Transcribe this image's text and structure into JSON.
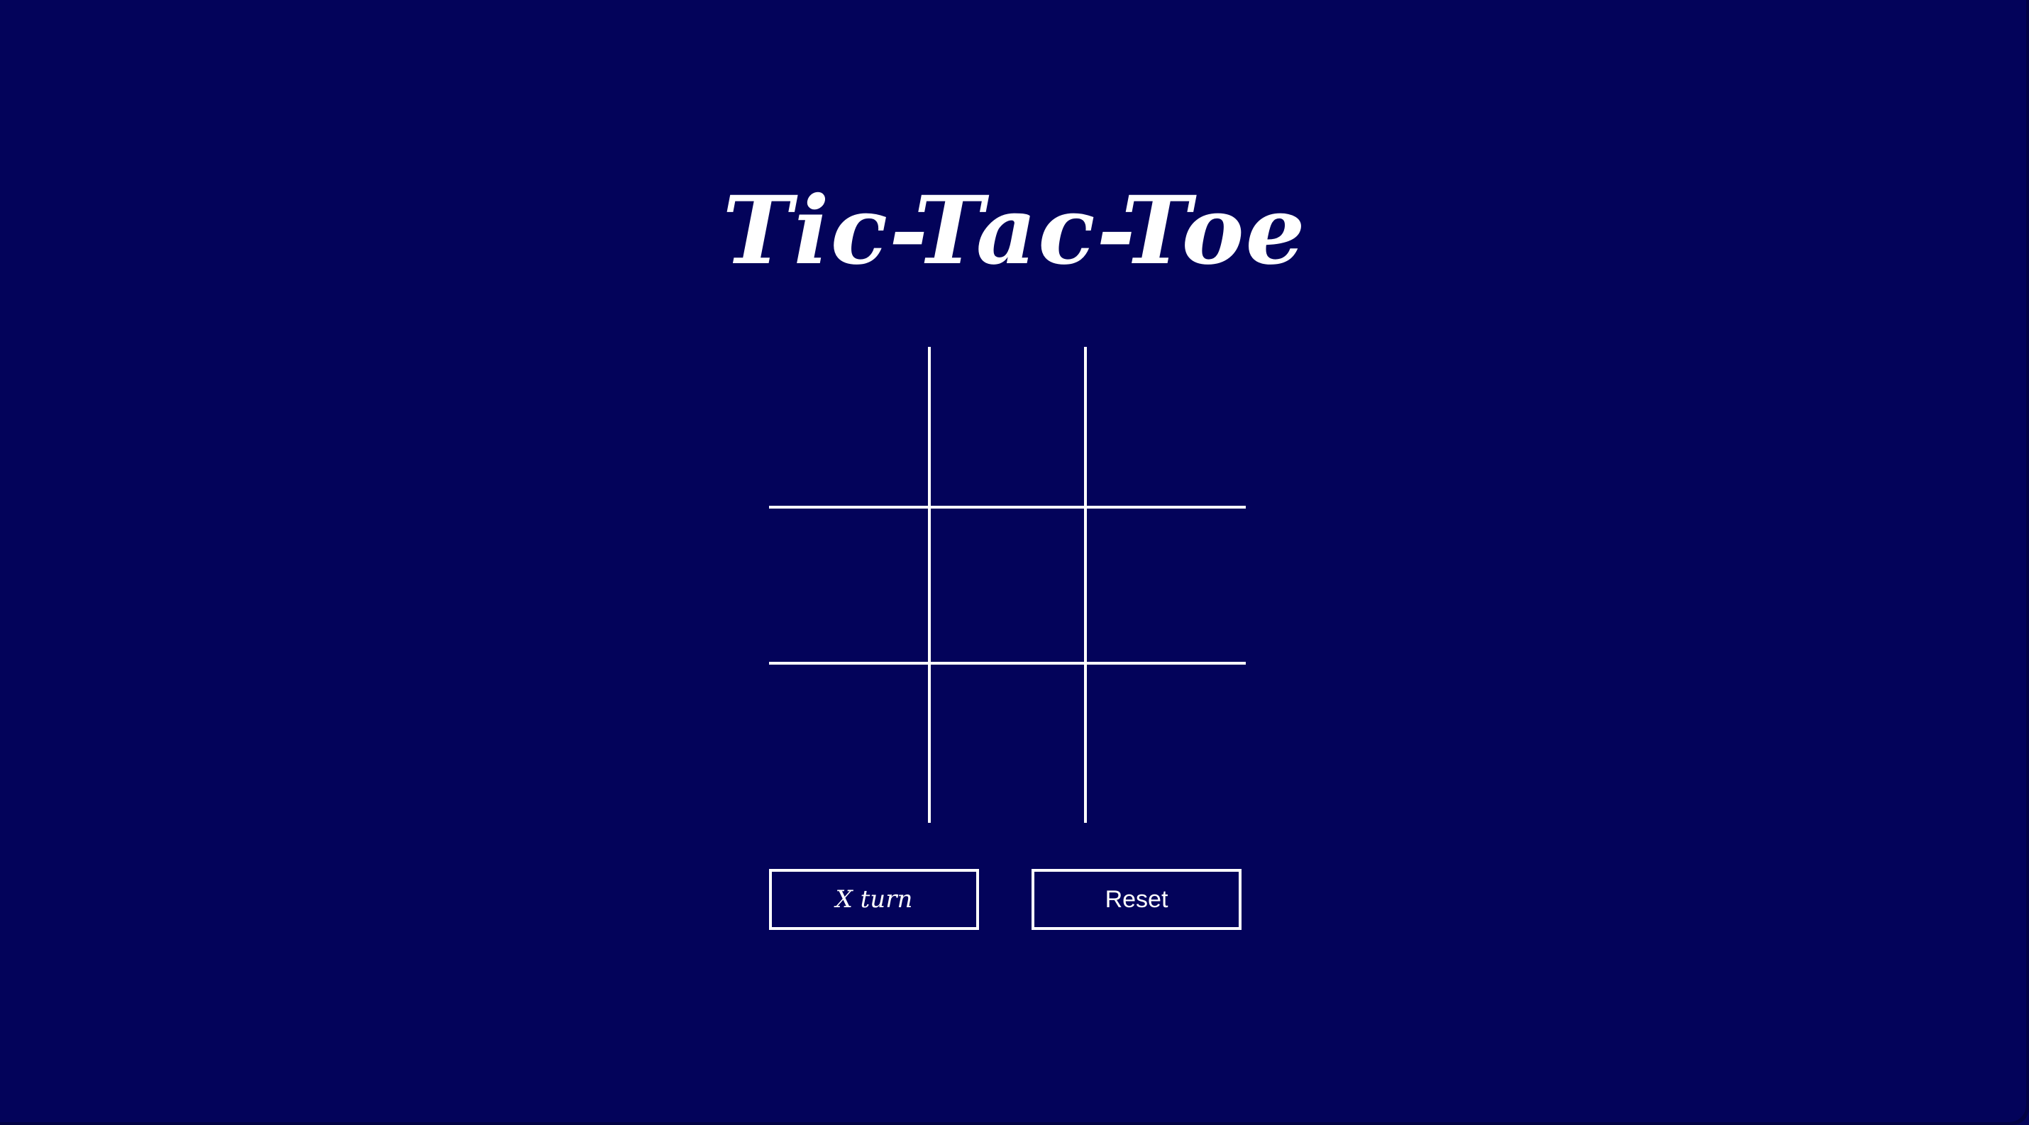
{
  "app": {
    "title": "Tic-Tac-Toe",
    "colors": {
      "background": "#03035a",
      "foreground": "#ffffff"
    }
  },
  "board": {
    "cells": [
      "",
      "",
      "",
      "",
      "",
      "",
      "",
      "",
      ""
    ]
  },
  "controls": {
    "turn_label": "X turn",
    "reset_label": "Reset"
  }
}
